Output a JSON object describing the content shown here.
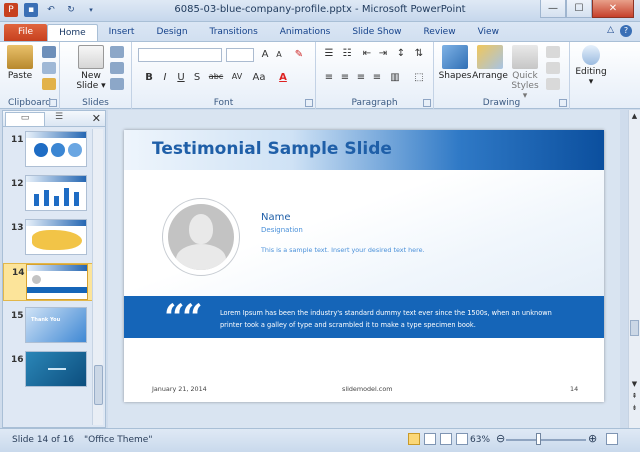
{
  "window": {
    "title": "6085-03-blue-company-profile.pptx - Microsoft PowerPoint",
    "minimize": "—",
    "maximize": "☐",
    "close": "✕"
  },
  "tabs": [
    "File",
    "Home",
    "Insert",
    "Design",
    "Transitions",
    "Animations",
    "Slide Show",
    "Review",
    "View"
  ],
  "active_tab": "Home",
  "ribbon": {
    "clipboard": {
      "label": "Clipboard",
      "paste": "Paste"
    },
    "slides": {
      "label": "Slides",
      "new_slide_line1": "New",
      "new_slide_line2": "Slide ▾"
    },
    "font": {
      "label": "Font",
      "font_name": "",
      "font_size": "",
      "bold": "B",
      "italic": "I",
      "underline": "U",
      "shadow": "S",
      "strike": "abc",
      "grow": "A",
      "shrink": "A",
      "case": "Aa",
      "color": "A"
    },
    "paragraph": {
      "label": "Paragraph"
    },
    "drawing": {
      "label": "Drawing",
      "shapes": "Shapes",
      "arrange": "Arrange",
      "quick_line1": "Quick",
      "quick_line2": "Styles ▾"
    },
    "editing": {
      "label": "Editing"
    }
  },
  "thumbnails": [
    {
      "num": "11"
    },
    {
      "num": "12"
    },
    {
      "num": "13"
    },
    {
      "num": "14",
      "selected": true
    },
    {
      "num": "15",
      "text": "Thank You"
    },
    {
      "num": "16"
    }
  ],
  "slide": {
    "title": "Testimonial Sample Slide",
    "name": "Name",
    "designation": "Designation",
    "sample_text": "This is a sample text. Insert your desired text here.",
    "quote_mark": "“",
    "band_text": "Lorem Ipsum has been the industry's standard dummy text ever since the 1500s, when an unknown printer took a galley of type and scrambled it to make a type specimen book.",
    "footer_date": "January 21, 2014",
    "footer_site": "slidemodel.com",
    "footer_page": "14"
  },
  "status": {
    "slide_info": "Slide 14 of 16",
    "theme": "\"Office Theme\"",
    "zoom": "63%"
  },
  "colors": {
    "accent": "#1565b8",
    "title_blue": "#1f5fa8",
    "file_tab": "#c7401e",
    "selection": "#fce49a"
  }
}
